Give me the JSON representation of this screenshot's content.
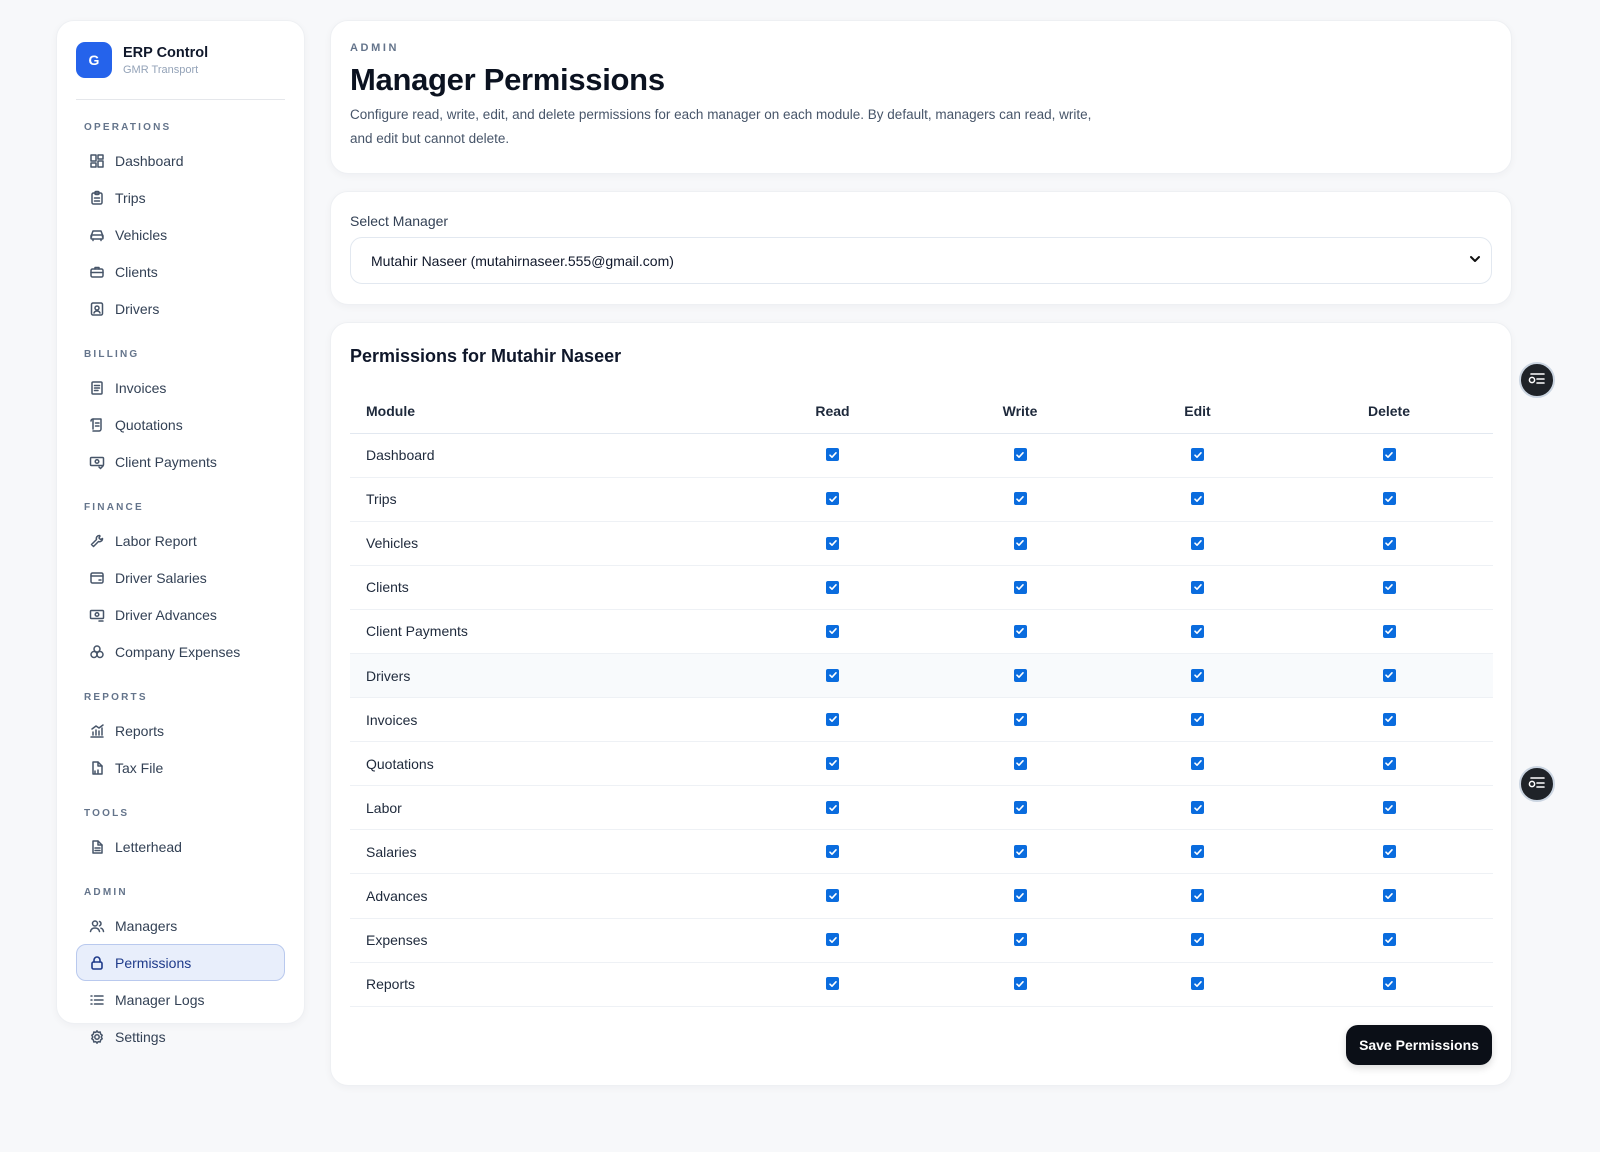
{
  "brand": {
    "logo_letter": "G",
    "title": "ERP Control",
    "subtitle": "GMR Transport",
    "color": "#2563eb"
  },
  "sidebar": {
    "sections": [
      {
        "title": "OPERATIONS",
        "items": [
          {
            "label": "Dashboard",
            "icon": "grid-icon"
          },
          {
            "label": "Trips",
            "icon": "clipboard-icon"
          },
          {
            "label": "Vehicles",
            "icon": "car-icon"
          },
          {
            "label": "Clients",
            "icon": "briefcase-icon"
          },
          {
            "label": "Drivers",
            "icon": "id-badge-icon"
          }
        ]
      },
      {
        "title": "BILLING",
        "items": [
          {
            "label": "Invoices",
            "icon": "document-icon"
          },
          {
            "label": "Quotations",
            "icon": "scroll-icon"
          },
          {
            "label": "Client Payments",
            "icon": "payment-icon"
          }
        ]
      },
      {
        "title": "FINANCE",
        "items": [
          {
            "label": "Labor Report",
            "icon": "wrench-icon"
          },
          {
            "label": "Driver Salaries",
            "icon": "wallet-icon"
          },
          {
            "label": "Driver Advances",
            "icon": "cash-icon"
          },
          {
            "label": "Company Expenses",
            "icon": "coins-icon"
          }
        ]
      },
      {
        "title": "REPORTS",
        "items": [
          {
            "label": "Reports",
            "icon": "chart-icon"
          },
          {
            "label": "Tax File",
            "icon": "file-icon"
          }
        ]
      },
      {
        "title": "TOOLS",
        "items": [
          {
            "label": "Letterhead",
            "icon": "letterhead-icon"
          }
        ]
      },
      {
        "title": "ADMIN",
        "items": [
          {
            "label": "Managers",
            "icon": "users-icon"
          },
          {
            "label": "Permissions",
            "icon": "lock-icon",
            "active": true
          },
          {
            "label": "Manager Logs",
            "icon": "list-icon"
          },
          {
            "label": "Settings",
            "icon": "gear-icon"
          }
        ]
      }
    ]
  },
  "header": {
    "eyebrow": "ADMIN",
    "title": "Manager Permissions",
    "description": "Configure read, write, edit, and delete permissions for each manager on each module. By default, managers can read, write, and edit but cannot delete."
  },
  "manager_select": {
    "label": "Select Manager",
    "selected": "Mutahir Naseer (mutahirnaseer.555@gmail.com)"
  },
  "permissions": {
    "title": "Permissions for Mutahir Naseer",
    "columns": [
      "Module",
      "Read",
      "Write",
      "Edit",
      "Delete"
    ],
    "rows": [
      {
        "module": "Dashboard",
        "read": true,
        "write": true,
        "edit": true,
        "delete": true
      },
      {
        "module": "Trips",
        "read": true,
        "write": true,
        "edit": true,
        "delete": true
      },
      {
        "module": "Vehicles",
        "read": true,
        "write": true,
        "edit": true,
        "delete": true
      },
      {
        "module": "Clients",
        "read": true,
        "write": true,
        "edit": true,
        "delete": true
      },
      {
        "module": "Client Payments",
        "read": true,
        "write": true,
        "edit": true,
        "delete": true
      },
      {
        "module": "Drivers",
        "read": true,
        "write": true,
        "edit": true,
        "delete": true
      },
      {
        "module": "Invoices",
        "read": true,
        "write": true,
        "edit": true,
        "delete": true
      },
      {
        "module": "Quotations",
        "read": true,
        "write": true,
        "edit": true,
        "delete": true
      },
      {
        "module": "Labor",
        "read": true,
        "write": true,
        "edit": true,
        "delete": true
      },
      {
        "module": "Salaries",
        "read": true,
        "write": true,
        "edit": true,
        "delete": true
      },
      {
        "module": "Advances",
        "read": true,
        "write": true,
        "edit": true,
        "delete": true
      },
      {
        "module": "Expenses",
        "read": true,
        "write": true,
        "edit": true,
        "delete": true
      },
      {
        "module": "Reports",
        "read": true,
        "write": true,
        "edit": true,
        "delete": true
      }
    ],
    "highlighted_row": "Drivers",
    "save_label": "Save Permissions"
  },
  "floating_buttons": [
    {
      "icon": "toggle-list-icon"
    },
    {
      "icon": "toggle-list-icon"
    }
  ],
  "colors": {
    "checkbox": "#0a6cde",
    "active_nav_bg": "#e8eefb",
    "save_button": "#0b0f17"
  }
}
